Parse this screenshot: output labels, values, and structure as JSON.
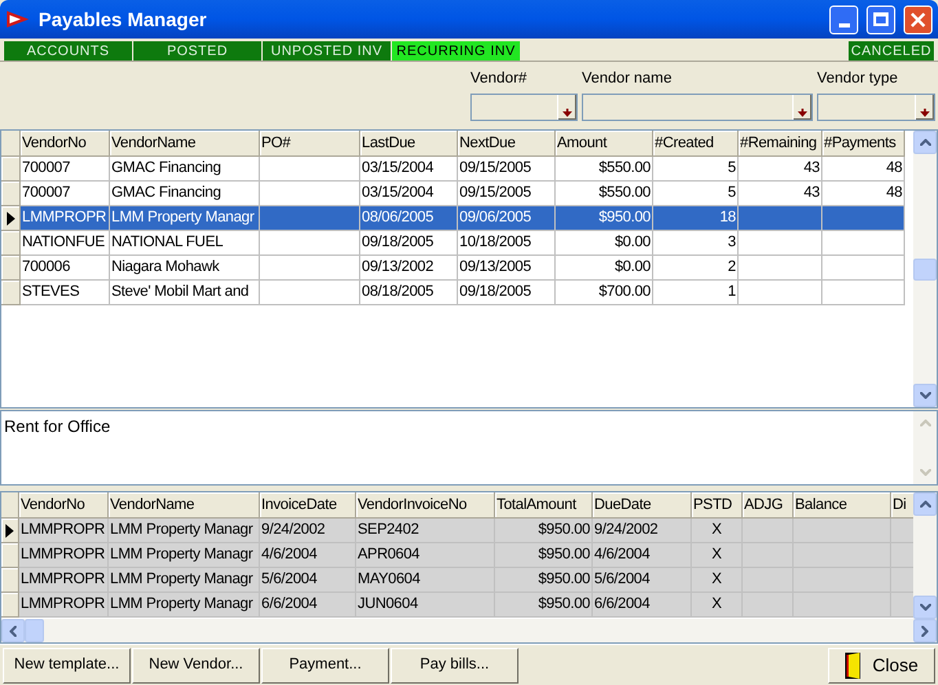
{
  "window": {
    "title": "Payables Manager"
  },
  "tabs": [
    {
      "label": "ACCOUNTS",
      "selected": false
    },
    {
      "label": "POSTED",
      "selected": false
    },
    {
      "label": "UNPOSTED INV",
      "selected": false
    },
    {
      "label": "RECURRING INV",
      "selected": true
    }
  ],
  "right_tabs": [
    {
      "label": "CANCELED",
      "selected": false
    }
  ],
  "filters": [
    {
      "label": "Vendor#"
    },
    {
      "label": "Vendor name"
    },
    {
      "label": "Vendor type"
    }
  ],
  "templates": {
    "columns": [
      "VendorNo",
      "VendorName",
      "PO#",
      "LastDue",
      "NextDue",
      "Amount",
      "#Created",
      "#Remaining",
      "#Payments"
    ],
    "rows": [
      {
        "selected": false,
        "cells": [
          "700007",
          "GMAC Financing",
          "",
          "03/15/2004",
          "09/15/2005",
          "$550.00",
          "5",
          "43",
          "48"
        ]
      },
      {
        "selected": false,
        "cells": [
          "700007",
          "GMAC Financing",
          "",
          "03/15/2004",
          "09/15/2005",
          "$550.00",
          "5",
          "43",
          "48"
        ]
      },
      {
        "selected": true,
        "cells": [
          "LMMPROPR",
          "LMM Property Managr",
          "",
          "08/06/2005",
          "09/06/2005",
          "$950.00",
          "18",
          "",
          ""
        ]
      },
      {
        "selected": false,
        "cells": [
          "NATIONFUE",
          "NATIONAL FUEL",
          "",
          "09/18/2005",
          "10/18/2005",
          "$0.00",
          "3",
          "",
          ""
        ]
      },
      {
        "selected": false,
        "cells": [
          "700006",
          "Niagara Mohawk",
          "",
          "09/13/2002",
          "09/13/2005",
          "$0.00",
          "2",
          "",
          ""
        ]
      },
      {
        "selected": false,
        "cells": [
          "STEVES",
          "Steve' Mobil Mart and",
          "",
          "08/18/2005",
          "09/18/2005",
          "$700.00",
          "1",
          "",
          ""
        ]
      }
    ]
  },
  "memo": "Rent for Office",
  "invoices": {
    "columns": [
      "VendorNo",
      "VendorName",
      "InvoiceDate",
      "VendorInvoiceNo",
      "TotalAmount",
      "DueDate",
      "PSTD",
      "ADJG",
      "Balance",
      "Di"
    ],
    "rows": [
      {
        "current": true,
        "cells": [
          "LMMPROPR",
          "LMM Property Managr",
          "9/24/2002",
          "SEP2402",
          "$950.00",
          "9/24/2002",
          "X",
          "",
          "",
          ""
        ]
      },
      {
        "current": false,
        "cells": [
          "LMMPROPR",
          "LMM Property Managr",
          "4/6/2004",
          "APR0604",
          "$950.00",
          "4/6/2004",
          "X",
          "",
          "",
          ""
        ]
      },
      {
        "current": false,
        "cells": [
          "LMMPROPR",
          "LMM Property Managr",
          "5/6/2004",
          "MAY0604",
          "$950.00",
          "5/6/2004",
          "X",
          "",
          "",
          ""
        ]
      },
      {
        "current": false,
        "cells": [
          "LMMPROPR",
          "LMM Property Managr",
          "6/6/2004",
          "JUN0604",
          "$950.00",
          "6/6/2004",
          "X",
          "",
          "",
          ""
        ]
      }
    ]
  },
  "buttons": [
    "New template...",
    "New Vendor...",
    "Payment...",
    "Pay bills..."
  ],
  "close_button": "Close"
}
